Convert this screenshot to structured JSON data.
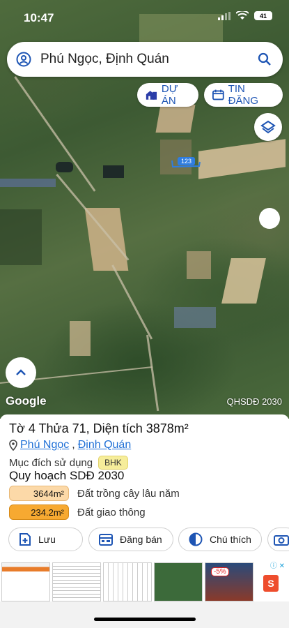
{
  "status": {
    "time": "10:47",
    "battery": "41"
  },
  "search": {
    "query": "Phú Ngọc, Định Quán"
  },
  "pills": {
    "du_an": "DỰ ÁN",
    "tin_dang": "TIN ĐĂNG"
  },
  "map": {
    "brand": "Google",
    "layer_code": "QHSDĐ 2030",
    "parcel_tag": "123"
  },
  "parcel": {
    "title_prefix": "Tờ",
    "sheet": "4",
    "lot_prefix": "Thửa",
    "lot": "71,",
    "area_prefix": "Diện tích",
    "area": "3878m²",
    "commune": "Phú Ngọc",
    "district": "Định Quán",
    "purpose_label": "Mục đích sử dụng",
    "purpose_code": "BHK",
    "plan_title": "Quy hoạch SDĐ 2030",
    "plans": [
      {
        "area": "3644m²",
        "label": "Đất trồng cây lâu năm",
        "color": "#fcd9a8"
      },
      {
        "area": "234.2m²",
        "label": "Đất giao thông",
        "color": "#f7a931"
      }
    ]
  },
  "actions": {
    "save": "Lưu",
    "post": "Đăng bán",
    "note": "Chú thích"
  },
  "ad": {
    "discount": "-5%"
  }
}
